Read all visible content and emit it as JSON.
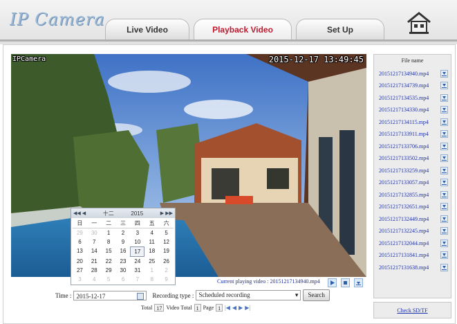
{
  "header": {
    "logo": "IP Camera",
    "tabs": [
      {
        "label": "Live Video",
        "active": false
      },
      {
        "label": "Playback Video",
        "active": true
      },
      {
        "label": "Set Up",
        "active": false
      }
    ]
  },
  "video": {
    "camera_label": "IPCamera",
    "timestamp": "2015-12-17 13:49:45"
  },
  "calendar": {
    "month": "十二",
    "year": "2015",
    "weekdays": [
      "日",
      "一",
      "二",
      "三",
      "四",
      "五",
      "六"
    ],
    "weeks": [
      [
        {
          "d": "29",
          "o": true
        },
        {
          "d": "30",
          "o": true
        },
        {
          "d": "1"
        },
        {
          "d": "2"
        },
        {
          "d": "3"
        },
        {
          "d": "4"
        },
        {
          "d": "5"
        }
      ],
      [
        {
          "d": "6"
        },
        {
          "d": "7"
        },
        {
          "d": "8"
        },
        {
          "d": "9"
        },
        {
          "d": "10"
        },
        {
          "d": "11"
        },
        {
          "d": "12"
        }
      ],
      [
        {
          "d": "13"
        },
        {
          "d": "14"
        },
        {
          "d": "15"
        },
        {
          "d": "16"
        },
        {
          "d": "17",
          "sel": true
        },
        {
          "d": "18"
        },
        {
          "d": "19"
        }
      ],
      [
        {
          "d": "20"
        },
        {
          "d": "21"
        },
        {
          "d": "22"
        },
        {
          "d": "23"
        },
        {
          "d": "24"
        },
        {
          "d": "25"
        },
        {
          "d": "26"
        }
      ],
      [
        {
          "d": "27"
        },
        {
          "d": "28"
        },
        {
          "d": "29"
        },
        {
          "d": "30"
        },
        {
          "d": "31"
        },
        {
          "d": "1",
          "o": true
        },
        {
          "d": "2",
          "o": true
        }
      ],
      [
        {
          "d": "3",
          "o": true
        },
        {
          "d": "4",
          "o": true
        },
        {
          "d": "5",
          "o": true
        },
        {
          "d": "6",
          "o": true
        },
        {
          "d": "7",
          "o": true
        },
        {
          "d": "8",
          "o": true
        },
        {
          "d": "9",
          "o": true
        }
      ]
    ]
  },
  "playback": {
    "current_label": "Current playing video :",
    "current_file": "20151217134940.mp4"
  },
  "search": {
    "time_label": "Time :",
    "time_value": "2015-12-17",
    "recording_type_label": "Recording type :",
    "recording_type_value": "Scheduled recording",
    "search_button": "Search"
  },
  "pager": {
    "total_label": "Total",
    "total_value": "17",
    "video_total_label": "Video Total",
    "video_total_value": "1",
    "page_label": "Page",
    "page_value": "1"
  },
  "files": {
    "title": "File name",
    "items": [
      "20151217134940.mp4",
      "20151217134739.mp4",
      "20151217134535.mp4",
      "20151217134330.mp4",
      "20151217134115.mp4",
      "20151217133911.mp4",
      "20151217133706.mp4",
      "20151217133502.mp4",
      "20151217133259.mp4",
      "20151217133057.mp4",
      "20151217132855.mp4",
      "20151217132651.mp4",
      "20151217132449.mp4",
      "20151217132245.mp4",
      "20151217132044.mp4",
      "20151217131841.mp4",
      "20151217131638.mp4"
    ],
    "check_link": "Check SD/TF"
  }
}
